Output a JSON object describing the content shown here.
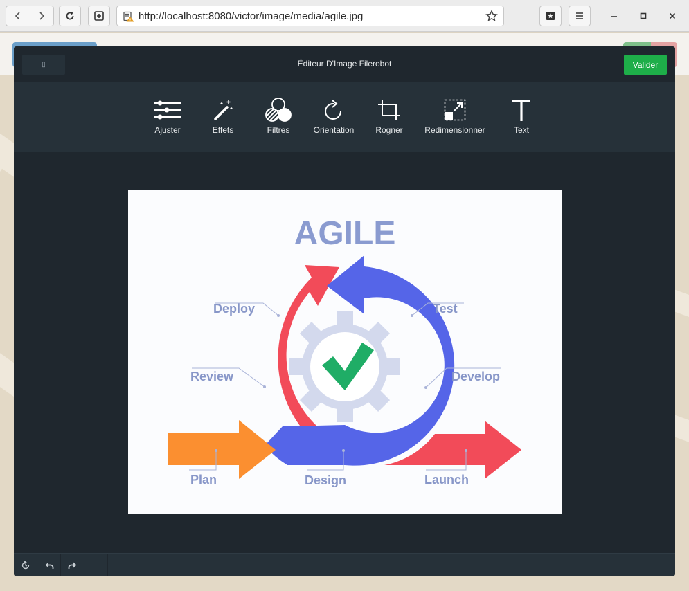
{
  "browser": {
    "url": "http://localhost:8080/victor/image/media/agile.jpg"
  },
  "editor": {
    "title": "Éditeur D'Image Filerobot",
    "close_label": "",
    "validate_label": "Valider",
    "tools": [
      {
        "label": "Ajuster",
        "icon": "sliders-icon"
      },
      {
        "label": "Effets",
        "icon": "magic-wand-icon"
      },
      {
        "label": "Filtres",
        "icon": "filters-circles-icon"
      },
      {
        "label": "Orientation",
        "icon": "rotate-icon"
      },
      {
        "label": "Rogner",
        "icon": "crop-icon"
      },
      {
        "label": "Redimensionner",
        "icon": "resize-icon"
      },
      {
        "label": "Text",
        "icon": "text-icon"
      }
    ]
  },
  "image": {
    "title": "AGILE",
    "labels": {
      "deploy": "Deploy",
      "test": "Test",
      "review": "Review",
      "develop": "Develop",
      "plan": "Plan",
      "design": "Design",
      "launch": "Launch"
    },
    "colors": {
      "red": "#f24b59",
      "blue": "#5565e8",
      "orange": "#fb8f30",
      "gear": "#d3d9ed",
      "check": "#1fad66",
      "text": "#8796c8"
    }
  }
}
